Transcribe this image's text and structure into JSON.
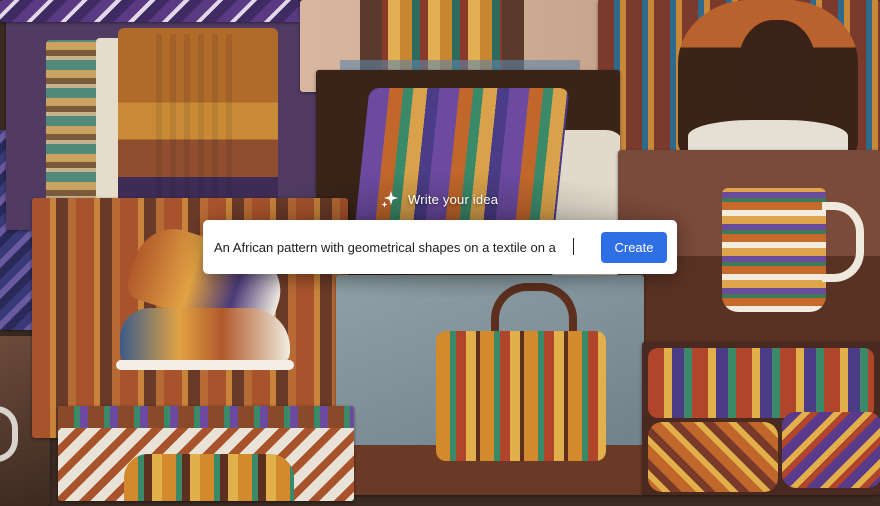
{
  "prompt": {
    "label": "Write your idea",
    "input_value": "An African pattern with geometrical shapes on a textile on a",
    "create_label": "Create"
  },
  "icons": {
    "sparkle": "sparkle-icon"
  },
  "colors": {
    "button": "#2f6fe6",
    "overlay_text": "#ffffff",
    "input_bg": "#ffffff"
  },
  "gallery": {
    "items": [
      "tshirts-image",
      "model-dress-image",
      "woman-headwrap-image",
      "pillow-image",
      "mug-image",
      "sneakers-image",
      "handbag-image",
      "sofa-cushions-image",
      "duffel-bag-image"
    ]
  }
}
